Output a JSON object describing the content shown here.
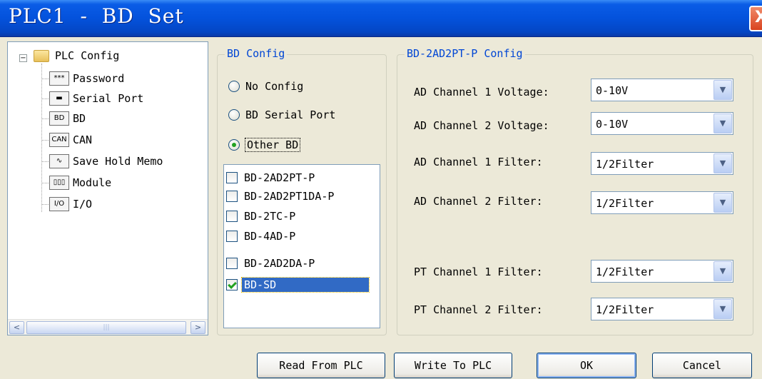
{
  "window": {
    "title": "PLC1  -  BD  Set",
    "close_glyph": "X"
  },
  "tree": {
    "root_label": "PLC Config",
    "expander_glyph": "−",
    "items": [
      {
        "label": "Password",
        "icon": "password-icon",
        "icon_text": "***"
      },
      {
        "label": "Serial Port",
        "icon": "serial-port-icon",
        "icon_text": "▬"
      },
      {
        "label": "BD",
        "icon": "bd-icon",
        "icon_text": "BD"
      },
      {
        "label": "CAN",
        "icon": "can-icon",
        "icon_text": "CAN"
      },
      {
        "label": "Save Hold Memo",
        "icon": "waveform-icon",
        "icon_text": "∿"
      },
      {
        "label": "Module",
        "icon": "module-icon",
        "icon_text": "▯▯▯"
      },
      {
        "label": "I/O",
        "icon": "io-icon",
        "icon_text": "I/O"
      }
    ],
    "scroll_left": "<",
    "scroll_right": ">",
    "scroll_grip": "|||"
  },
  "bd_config": {
    "legend": "BD Config",
    "options": [
      {
        "label": "No Config",
        "checked": false
      },
      {
        "label": "BD Serial Port",
        "checked": false
      },
      {
        "label": "Other BD",
        "checked": true
      }
    ],
    "boards": [
      {
        "label": "BD-2AD2PT-P",
        "checked": false
      },
      {
        "label": "BD-2AD2PT1DA-P",
        "checked": false
      },
      {
        "label": "BD-2TC-P",
        "checked": false
      },
      {
        "label": "BD-4AD-P",
        "checked": false
      },
      {
        "label": "BD-2AD2DA-P",
        "checked": false
      },
      {
        "label": "BD-SD",
        "checked": true
      }
    ]
  },
  "module_config": {
    "legend": "BD-2AD2PT-P Config",
    "fields": [
      {
        "label": "AD Channel 1 Voltage:",
        "value": "0-10V"
      },
      {
        "label": "AD Channel 2 Voltage:",
        "value": "0-10V"
      },
      {
        "label": "AD Channel 1 Filter:",
        "value": "1/2Filter"
      },
      {
        "label": "AD Channel 2 Filter:",
        "value": "1/2Filter"
      },
      {
        "label": "PT Channel 1 Filter:",
        "value": "1/2Filter"
      },
      {
        "label": "PT Channel 2 Filter:",
        "value": "1/2Filter"
      }
    ],
    "dropdown_glyph": "▼"
  },
  "buttons": {
    "read": "Read From PLC",
    "write": "Write To PLC",
    "ok": "OK",
    "cancel": "Cancel"
  },
  "colors": {
    "title_bar": "#0452dc",
    "legend_text": "#0046d5",
    "selection": "#316ac5",
    "check_green": "#21a121",
    "dialog_bg": "#ece9d8"
  }
}
